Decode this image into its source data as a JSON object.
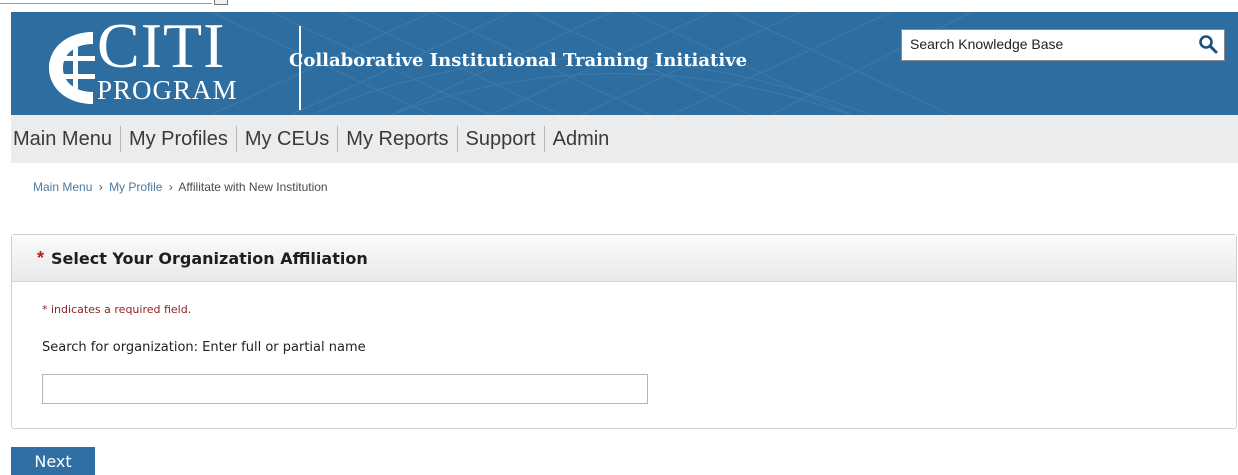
{
  "branding": {
    "logo_main": "CITI",
    "logo_sub": "PROGRAM",
    "tagline": "Collaborative Institutional Training Initiative"
  },
  "kb_search": {
    "placeholder": "Search Knowledge Base",
    "icon": "search-icon"
  },
  "nav": {
    "items": [
      "Main Menu",
      "My Profiles",
      "My CEUs",
      "My Reports",
      "Support",
      "Admin"
    ]
  },
  "breadcrumb": {
    "items": [
      "Main Menu",
      "My Profile",
      "Affilitate with New Institution"
    ],
    "separator": "›"
  },
  "panel": {
    "required_marker": "*",
    "title": "Select Your Organization Affiliation",
    "required_note": "* indicates a required field.",
    "search_label": "Search for organization: Enter full or partial name",
    "search_value": ""
  },
  "actions": {
    "next_label": "Next"
  },
  "colors": {
    "banner": "#2e6d9f",
    "nav_bg": "#ececec",
    "button": "#2f6fa4",
    "required": "#b22222"
  }
}
